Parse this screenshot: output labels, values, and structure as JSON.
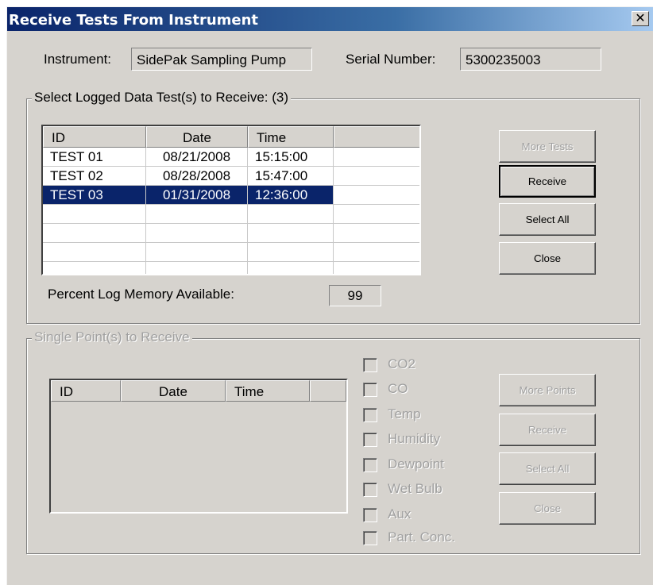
{
  "window": {
    "title": "Receive Tests From Instrument",
    "close_glyph": "✕"
  },
  "instrument": {
    "label": "Instrument:",
    "value": "SidePak Sampling Pump"
  },
  "serial": {
    "label": "Serial Number:",
    "value": "5300235003"
  },
  "logged": {
    "legend": "Select Logged Data Test(s) to Receive: (3)",
    "columns": [
      "ID",
      "Date",
      "Time",
      ""
    ],
    "rows": [
      {
        "id": "TEST 01",
        "date": "08/21/2008",
        "time": "15:15:00",
        "selected": false
      },
      {
        "id": "TEST 02",
        "date": "08/28/2008",
        "time": "15:47:00",
        "selected": false
      },
      {
        "id": "TEST 03",
        "date": "01/31/2008",
        "time": "12:36:00",
        "selected": true
      }
    ],
    "memory_label": "Percent Log Memory Available:",
    "memory_value": "99",
    "buttons": {
      "more": "More Tests",
      "receive": "Receive",
      "select_all": "Select All",
      "close": "Close"
    }
  },
  "single": {
    "legend": "Single Point(s) to Receive",
    "columns": [
      "ID",
      "Date",
      "Time",
      ""
    ],
    "checkboxes": [
      "CO2",
      "CO",
      "Temp",
      "Humidity",
      "Dewpoint",
      "Wet Bulb",
      "Aux",
      "Part. Conc."
    ],
    "buttons": {
      "more": "More Points",
      "receive": "Receive",
      "select_all": "Select All",
      "close": "Close"
    }
  }
}
